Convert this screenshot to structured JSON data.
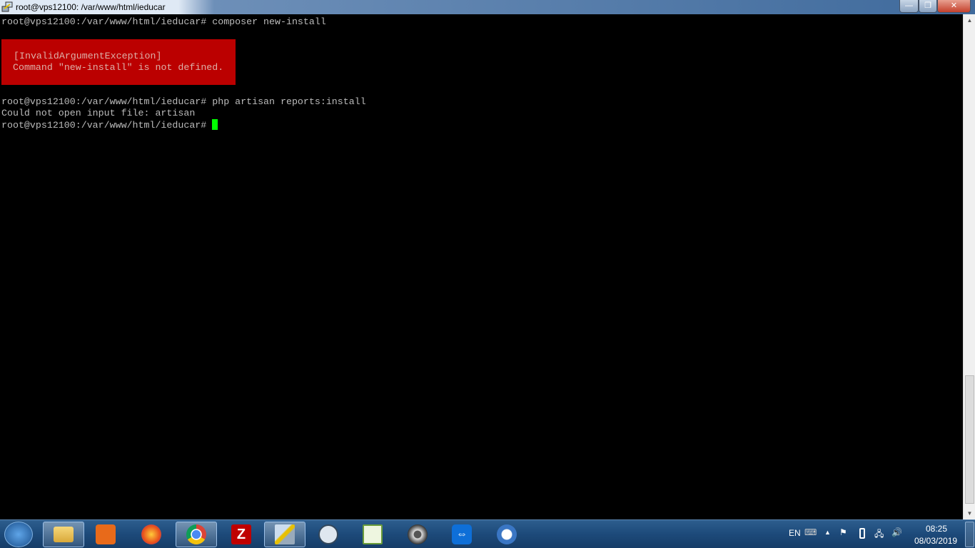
{
  "window": {
    "title": "root@vps12100: /var/www/html/ieducar",
    "minimize": "—",
    "maximize": "❐",
    "close": "✕"
  },
  "terminal": {
    "lines": [
      "root@vps12100:/var/www/html/ieducar# composer new-install",
      "root@vps12100:/var/www/html/ieducar# php artisan reports:install",
      "Could not open input file: artisan",
      "root@vps12100:/var/www/html/ieducar# "
    ],
    "error": {
      "title": "[InvalidArgumentException]",
      "message": "Command \"new-install\" is not defined."
    }
  },
  "taskbar": {
    "apps": [
      "file-explorer",
      "media-player",
      "firefox",
      "chrome",
      "filezilla",
      "putty",
      "pgadmin",
      "notepad",
      "video-app",
      "teamviewer",
      "thunderbird"
    ],
    "tray": {
      "language": "EN",
      "time": "08:25",
      "date": "08/03/2019"
    }
  },
  "colors": {
    "error_bg": "#bb0000",
    "cursor": "#00ff00",
    "text": "#bbbbbb"
  }
}
